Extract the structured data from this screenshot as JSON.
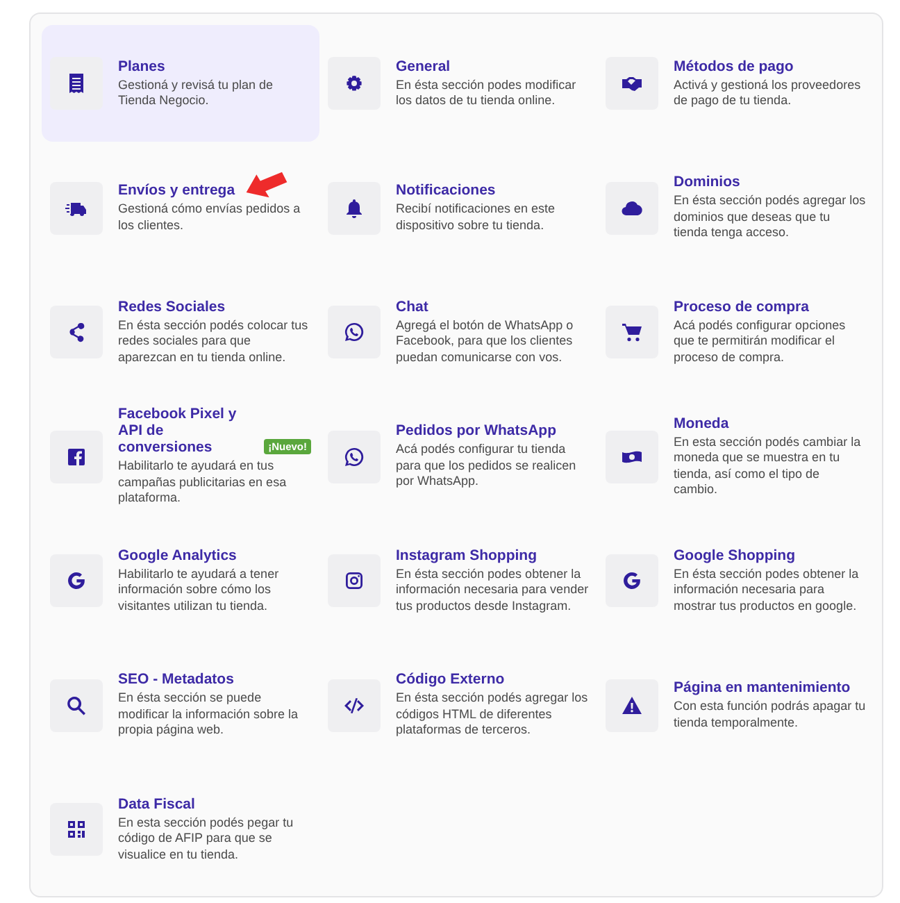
{
  "sections": [
    {
      "title": "Planes",
      "description": "Gestioná y revisá tu plan de Tienda Negocio.",
      "selected": true,
      "annotated": false
    },
    {
      "title": "General",
      "description": "En ésta sección podes modificar los datos de tu tienda online.",
      "selected": false,
      "annotated": false
    },
    {
      "title": "Métodos de pago",
      "description": "Activá y gestioná los proveedores de pago de tu tienda.",
      "selected": false,
      "annotated": false
    },
    {
      "title": "Envíos y entrega",
      "description": "Gestioná cómo envías pedidos a los clientes.",
      "selected": false,
      "annotated": true
    },
    {
      "title": "Notificaciones",
      "description": "Recibí notificaciones en este dispositivo sobre tu tienda.",
      "selected": false,
      "annotated": false
    },
    {
      "title": "Dominios",
      "description": "En ésta sección podés agregar los dominios que deseas que tu tienda tenga acceso.",
      "selected": false,
      "annotated": false
    },
    {
      "title": "Redes Sociales",
      "description": "En ésta sección podés colocar tus redes sociales para que aparezcan en tu tienda online.",
      "selected": false,
      "annotated": false
    },
    {
      "title": "Chat",
      "description": "Agregá el botón de WhatsApp o Facebook, para que los clientes puedan comunicarse con vos.",
      "selected": false,
      "annotated": false
    },
    {
      "title": "Proceso de compra",
      "description": "Acá podés configurar opciones que te permitirán modificar el proceso de compra.",
      "selected": false,
      "annotated": false
    },
    {
      "title": "Facebook Pixel y\nAPI de conversiones",
      "badge": "¡Nuevo!",
      "description": "Habilitarlo te ayudará en tus campañas publicitarias en esa plataforma.",
      "selected": false,
      "annotated": false
    },
    {
      "title": "Pedidos por WhatsApp",
      "description": "Acá podés configurar tu tienda para que los pedidos se realicen por WhatsApp.",
      "selected": false,
      "annotated": false
    },
    {
      "title": "Moneda",
      "description": "En esta sección podés cambiar la moneda que se muestra en tu tienda, así como el tipo de cambio.",
      "selected": false,
      "annotated": false
    },
    {
      "title": "Google Analytics",
      "description": "Habilitarlo te ayudará a tener información sobre cómo los visitantes utilizan tu tienda.",
      "selected": false,
      "annotated": false
    },
    {
      "title": "Instagram Shopping",
      "description": "En ésta sección podes obtener la información necesaria para vender tus productos desde Instagram.",
      "selected": false,
      "annotated": false
    },
    {
      "title": "Google Shopping",
      "description": "En ésta sección podes obtener la información necesaria para mostrar tus productos en google.",
      "selected": false,
      "annotated": false
    },
    {
      "title": "SEO - Metadatos",
      "description": "En ésta sección se puede modificar la información sobre la propia página web.",
      "selected": false,
      "annotated": false
    },
    {
      "title": "Código Externo",
      "description": "En ésta sección podés agregar los códigos HTML de diferentes plataformas de terceros.",
      "selected": false,
      "annotated": false
    },
    {
      "title": "Página en mantenimiento",
      "description": "Con esta función podrás apagar tu tienda temporalmente.",
      "selected": false,
      "annotated": false
    },
    {
      "title": "Data Fiscal",
      "description": "En esta sección podés pegar tu código de AFIP para que se visualice en tu tienda.",
      "selected": false,
      "annotated": false
    }
  ]
}
